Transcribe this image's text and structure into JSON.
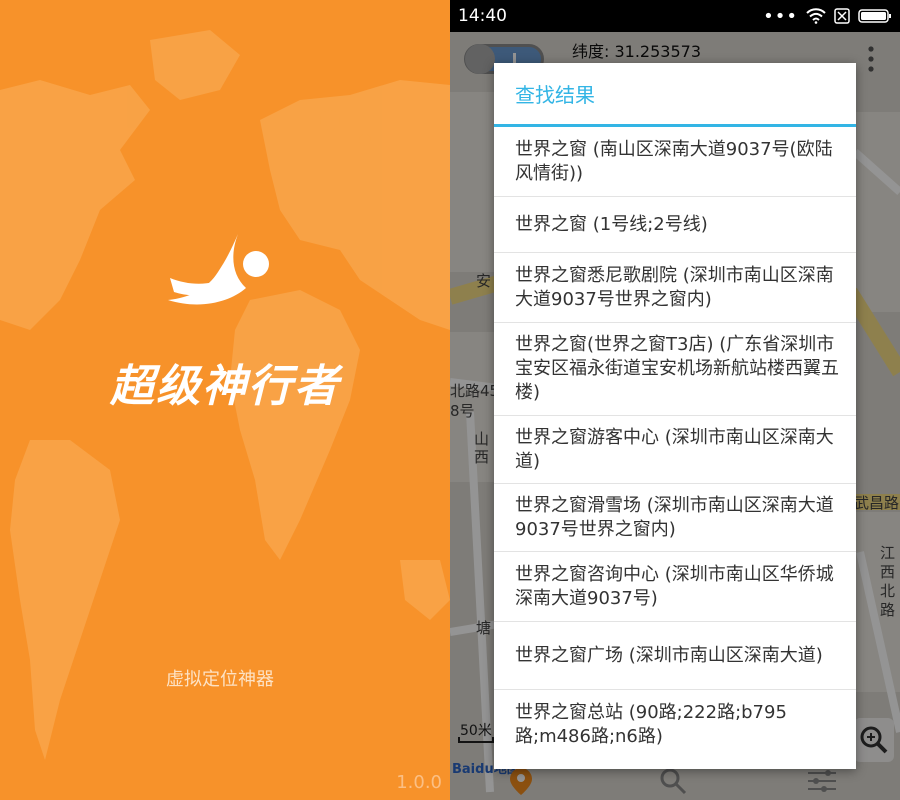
{
  "splash": {
    "app_name": "超级神行者",
    "tagline": "虚拟定位神器",
    "version": "1.0.0",
    "logo_icon": "runner-logo-icon",
    "background_color": "#f7922a"
  },
  "status_bar": {
    "time": "14:40",
    "icons": [
      "more-dots-icon",
      "wifi-icon",
      "sim-off-icon",
      "battery-icon"
    ]
  },
  "toolbar": {
    "latitude_text": "纬度: 31.253573",
    "toggle_state": "on",
    "menu_icon": "overflow-menu-icon"
  },
  "map": {
    "labels": {
      "an": "安",
      "road": "北路45",
      "num": "8号",
      "shan": "山西",
      "wuchang": "武昌路",
      "jiangxi": "江西北路",
      "tang": "塘"
    },
    "scale": "50米",
    "provider": "Baidu地图",
    "zoom_icon": "zoom-in-icon"
  },
  "dialog": {
    "title": "查找结果",
    "accent_color": "#33b5e5",
    "results": [
      {
        "label": "世界之窗 (南山区深南大道9037号(欧陆风情街))"
      },
      {
        "label": "世界之窗 (1号线;2号线)"
      },
      {
        "label": "世界之窗悉尼歌剧院 (深圳市南山区深南大道9037号世界之窗内)"
      },
      {
        "label": "世界之窗(世界之窗T3店) (广东省深圳市宝安区福永街道宝安机场新航站楼西翼五楼)"
      },
      {
        "label": "世界之窗游客中心 (深圳市南山区深南大道)"
      },
      {
        "label": "世界之窗滑雪场 (深圳市南山区深南大道9037号世界之窗内)"
      },
      {
        "label": "世界之窗咨询中心 (深圳市南山区华侨城深南大道9037号)"
      },
      {
        "label": "世界之窗广场 (深圳市南山区深南大道)"
      },
      {
        "label": "世界之窗总站 (90路;222路;b795路;m486路;n6路)"
      }
    ]
  },
  "bottom_bar": {
    "icons": [
      "location-pin-icon",
      "search-icon",
      "settings-sliders-icon"
    ]
  }
}
